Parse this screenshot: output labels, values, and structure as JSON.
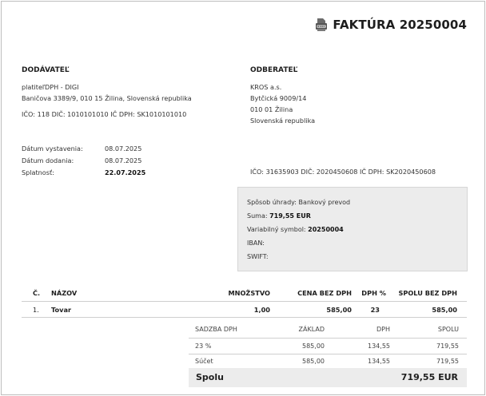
{
  "title": "FAKTÚRA 20250004",
  "supplier": {
    "heading": "DODÁVATEĽ",
    "name": "platiteľDPH - DIGI",
    "address": "Baničova 3389/9, 010 15 Žilina, Slovenská republika",
    "ids": "IČO: 118   DIČ: 1010101010   IČ DPH: SK1010101010"
  },
  "customer": {
    "heading": "ODBERATEĽ",
    "name": "KROS a.s.",
    "street": "Bytčická 9009/14",
    "city": "010 01 Žilina",
    "country": "Slovenská republika",
    "ids": "IČO: 31635903   DIČ: 2020450608   IČ DPH: SK2020450608"
  },
  "dates": [
    {
      "label": "Dátum vystavenia:",
      "value": "08.07.2025"
    },
    {
      "label": "Dátum dodania:",
      "value": "08.07.2025"
    },
    {
      "label": "Splatnosť:",
      "value": "22.07.2025"
    }
  ],
  "payment": {
    "method_label": "Spôsob úhrady:",
    "method_value": "Bankový prevod",
    "sum_label": "Suma:",
    "sum_value": "719,55 EUR",
    "vs_label": "Variabilný symbol:",
    "vs_value": "20250004",
    "iban_label": "IBAN:",
    "swift_label": "SWIFT:"
  },
  "items_table": {
    "headers": [
      "Č.",
      "NÁZOV",
      "MNOŽSTVO",
      "CENA BEZ DPH",
      "DPH %",
      "SPOLU BEZ DPH"
    ],
    "rows": [
      [
        "1.",
        "Tovar",
        "1,00",
        "585,00",
        "23",
        "585,00"
      ]
    ]
  },
  "vat_table": {
    "headers": [
      "SADZBA DPH",
      "ZÁKLAD",
      "DPH",
      "SPOLU"
    ],
    "rows": [
      [
        "23 %",
        "585,00",
        "134,55",
        "719,55"
      ],
      [
        "Súčet",
        "585,00",
        "134,55",
        "719,55"
      ]
    ]
  },
  "total": {
    "label": "Spolu",
    "value": "719,55 EUR"
  },
  "icons": {
    "document": "document-icon"
  }
}
